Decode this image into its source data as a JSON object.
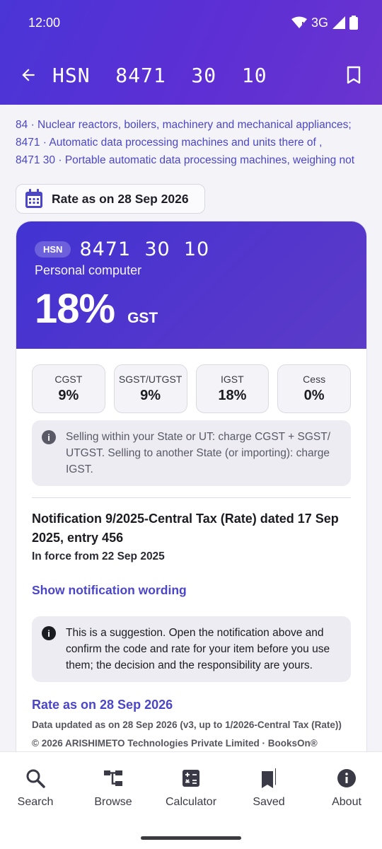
{
  "status": {
    "time": "12:00",
    "network": "3G"
  },
  "header": {
    "title": "HSN  8471  30  10"
  },
  "breadcrumbs": [
    {
      "code": "84",
      "text": "Nuclear reactors, boilers, machinery and mechanical appliances;"
    },
    {
      "code": "8471",
      "text": "Automatic data processing machines and units there of ,"
    },
    {
      "code": "8471 30",
      "text": "Portable automatic data processing machines, weighing not"
    }
  ],
  "separator": "·",
  "rate_chip": {
    "label": "Rate as on 28 Sep 2026"
  },
  "card": {
    "badge": "HSN",
    "code": "8471  30  10",
    "description": "Personal computer",
    "rate": "18%",
    "rate_type": "GST",
    "tiles": [
      {
        "label": "CGST",
        "value": "9%"
      },
      {
        "label": "SGST/UTGST",
        "value": "9%"
      },
      {
        "label": "IGST",
        "value": "18%"
      },
      {
        "label": "Cess",
        "value": "0%"
      }
    ],
    "info": "Selling within your State or UT: charge CGST + SGST/ UTGST. Selling to another State (or importing): charge IGST.",
    "notification_title": "Notification 9/2025-Central Tax (Rate) dated 17 Sep 2025, entry 456",
    "in_force": "In force from 22 Sep 2025",
    "show_wording": "Show notification wording",
    "notice": "This is a suggestion. Open the notification above and confirm the code and rate for your item before you use them; the decision and the responsibility are yours.",
    "rate_link": "Rate as on 28 Sep 2026",
    "data_updated": "Data updated as on 28 Sep 2026 (v3, up to 1/2026-Central Tax (Rate))",
    "copyright": "© 2026 ARISHIMETO Technologies Private Limited · BooksOn®"
  },
  "nav": [
    {
      "label": "Search",
      "icon": "search-icon"
    },
    {
      "label": "Browse",
      "icon": "browse-tree-icon"
    },
    {
      "label": "Calculator",
      "icon": "calculator-icon"
    },
    {
      "label": "Saved",
      "icon": "bookmarks-icon"
    },
    {
      "label": "About",
      "icon": "info-icon"
    }
  ],
  "colors": {
    "accent": "#4b46c8",
    "hero_start": "#4133d3",
    "hero_end": "#5b3cc8"
  }
}
